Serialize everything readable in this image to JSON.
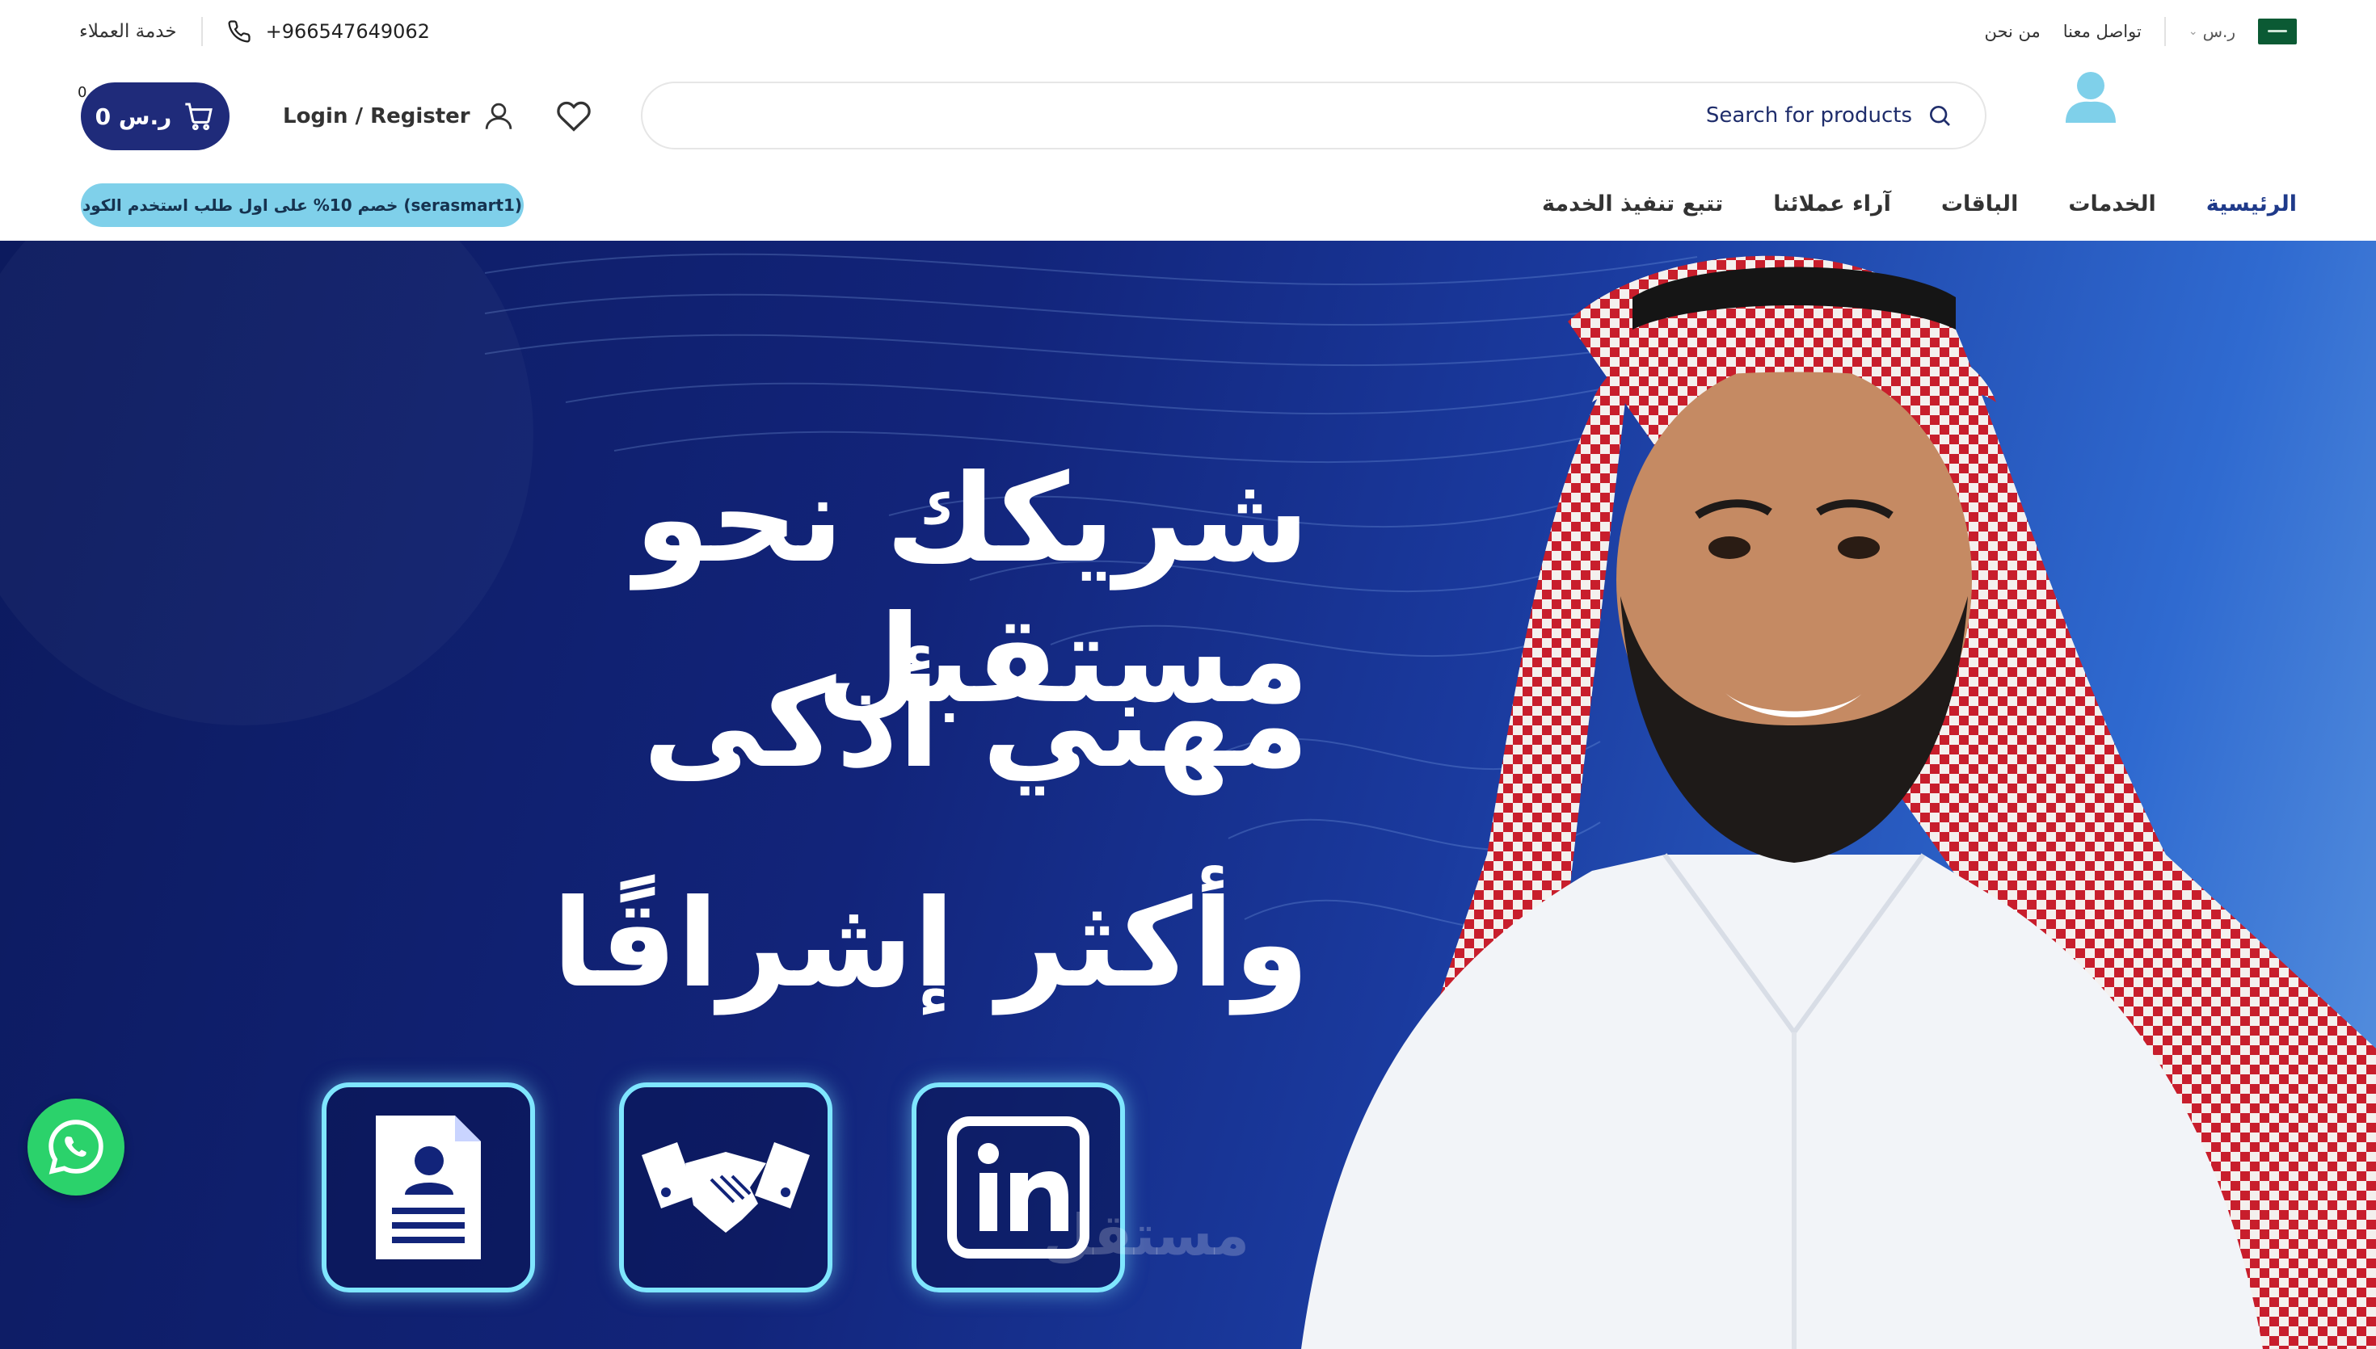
{
  "topbar": {
    "currency": "ر.س",
    "about_link": "من نحن",
    "contact_link": "تواصل معنا",
    "phone": "+966547649062",
    "customer_service": "خدمة العملاء"
  },
  "header": {
    "search_placeholder": "Search for products",
    "login_label": "Login / Register",
    "cart_total": "0 ر.س",
    "cart_count": "0"
  },
  "nav": {
    "items": [
      {
        "label": "الرئيسية",
        "active": true
      },
      {
        "label": "الخدمات",
        "active": false
      },
      {
        "label": "الباقات",
        "active": false
      },
      {
        "label": "آراء عملائنا",
        "active": false
      },
      {
        "label": "تتبع تنفيذ الخدمة",
        "active": false
      }
    ],
    "promo": "خصم 10% على اول طلب استخدم الكود (serasmart1)"
  },
  "hero": {
    "line1": "شريكك نحو مستقبل",
    "line2": "مهني أذكى",
    "line3": "وأكثر إشراقًا",
    "watermark": "مستقل"
  },
  "colors": {
    "primary": "#1f2b7a",
    "accent": "#7fd0ea",
    "whatsapp": "#2bd26b",
    "hero_dark": "#0c1a5e"
  },
  "icons": [
    "flag-icon",
    "phone-icon",
    "search-icon",
    "heart-icon",
    "user-icon",
    "cart-icon",
    "resume-icon",
    "handshake-icon",
    "linkedin-icon",
    "whatsapp-icon"
  ]
}
